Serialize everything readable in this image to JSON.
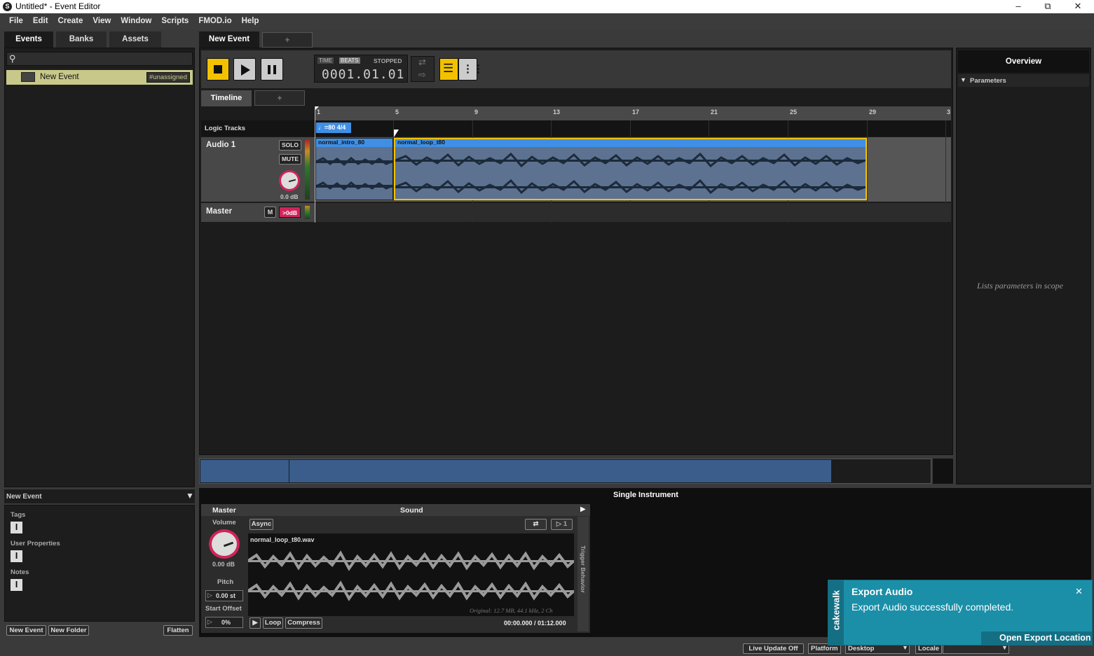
{
  "window": {
    "title": "Untitled* - Event Editor",
    "app_icon": "fmod-logo"
  },
  "menu": [
    "File",
    "Edit",
    "Create",
    "View",
    "Window",
    "Scripts",
    "FMOD.io",
    "Help"
  ],
  "browser": {
    "tabs": [
      "Events",
      "Banks",
      "Assets"
    ],
    "search_placeholder": "",
    "items": [
      {
        "name": "New Event",
        "badge": "#unassigned"
      }
    ],
    "properties_title": "New Event",
    "tags_label": "Tags",
    "user_properties_label": "User Properties",
    "notes_label": "Notes",
    "buttons": {
      "new_event": "New Event",
      "new_folder": "New Folder",
      "flatten": "Flatten"
    }
  },
  "editor": {
    "tab": "New Event",
    "tab_add": "+",
    "transport": {
      "time_label": "TIME",
      "beats_label": "BEATS",
      "state": "STOPPED",
      "position": "0001.01.01"
    },
    "timeline_tab": "Timeline",
    "timeline_add": "+",
    "ruler": [
      "1",
      "5",
      "9",
      "13",
      "17",
      "21",
      "25",
      "29",
      "3"
    ],
    "logic_tracks_label": "Logic Tracks",
    "tempo_marker": "♩=80 4/4",
    "tracks": [
      {
        "name": "Audio 1",
        "solo": "SOLO",
        "mute": "MUTE",
        "volume": "0.0 dB",
        "instruments": [
          "normal_intro_80",
          "normal_loop_t80"
        ]
      }
    ],
    "master": {
      "name": "Master",
      "m": "M",
      "level": ">0dB"
    }
  },
  "overview": {
    "title": "Overview",
    "parameters_label": "Parameters",
    "placeholder": "Lists parameters in scope"
  },
  "deck": {
    "title": "Single Instrument",
    "master_label": "Master",
    "sound_label": "Sound",
    "volume_label": "Volume",
    "volume_value": "0.00 dB",
    "pitch_label": "Pitch",
    "pitch_value": "0.00 st",
    "start_offset_label": "Start Offset",
    "start_offset_value": "0%",
    "async": "Async",
    "loop_count": "1",
    "file_name": "normal_loop_t80.wav",
    "file_info": "Original: 12.7 MB, 44.1 kHz, 2 Ch",
    "duration": "00:00.000 / 01:12.000",
    "loop": "Loop",
    "compress": "Compress",
    "trigger_behavior": "Trigger Behavior"
  },
  "statusbar": {
    "live_update": "Live Update Off",
    "platform_label": "Platform",
    "platform_value": "Desktop",
    "locale_label": "Locale"
  },
  "notification": {
    "brand": "cakewalk",
    "title": "Export Audio",
    "message": "Export Audio successfully completed.",
    "action": "Open Export Location"
  },
  "colors": {
    "accent_yellow": "#f2c200",
    "region_blue": "#3f8fe6",
    "waveform_bg": "#5c7290",
    "notification_bg": "#1b8fa8"
  }
}
